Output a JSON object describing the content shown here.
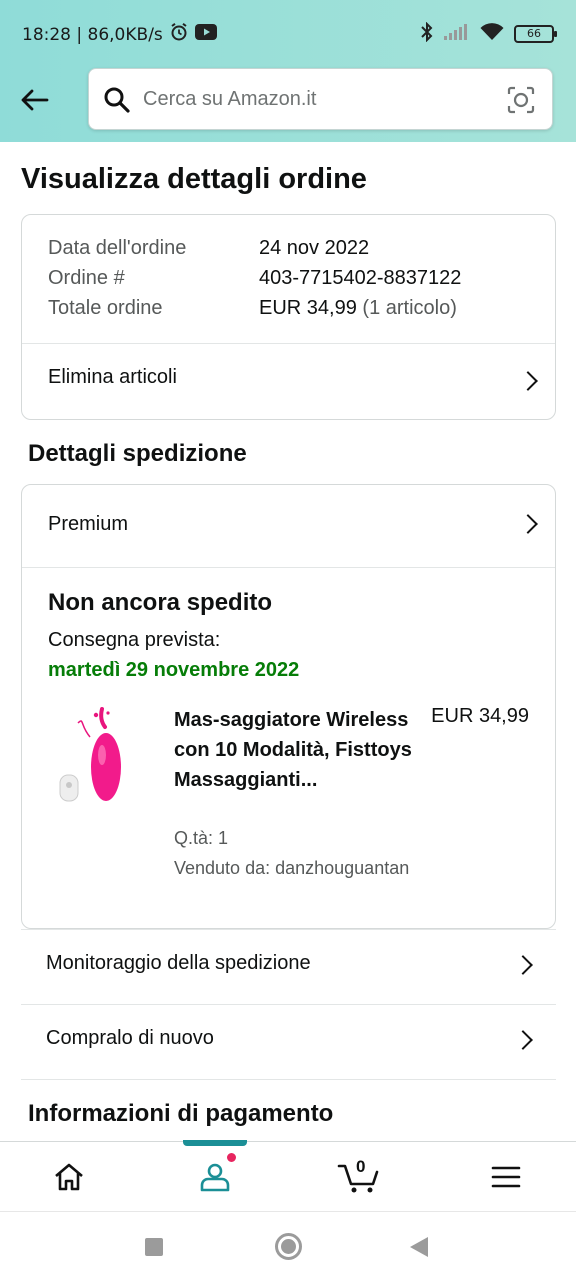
{
  "status_bar": {
    "time_speed": "18:28 | 86,0KB/s",
    "battery": "66"
  },
  "header": {
    "search_placeholder": "Cerca su Amazon.it"
  },
  "page": {
    "title": "Visualizza dettagli ordine"
  },
  "order_summary": {
    "rows": [
      {
        "label": "Data dell'ordine",
        "value": "24 nov 2022"
      },
      {
        "label": "Ordine #",
        "value": "403-7715402-8837122"
      },
      {
        "label": "Totale ordine",
        "value": "EUR 34,99",
        "extra": "(1 articolo)"
      }
    ],
    "action_label": "Elimina articoli"
  },
  "shipping": {
    "section_title": "Dettagli spedizione",
    "method": "Premium",
    "status": "Non ancora spedito",
    "delivery_label": "Consegna prevista:",
    "delivery_date": "martedì 29 novembre 2022",
    "product": {
      "title": "Mas-saggiatore Wireless con 10 Modalità, Fisttoys Massaggianti...",
      "price": "EUR 34,99",
      "qty": "Q.tà: 1",
      "seller": "Venduto da: danzhouguantan"
    }
  },
  "actions": [
    {
      "label": "Monitoraggio della spedizione"
    },
    {
      "label": "Compralo di nuovo"
    }
  ],
  "payment": {
    "section_title": "Informazioni di pagamento"
  },
  "bottom_nav": {
    "items": [
      "home-icon",
      "account-icon",
      "cart-icon",
      "menu-icon"
    ],
    "cart_count": "0",
    "active": "account"
  },
  "colors": {
    "accent": "#1b8f96",
    "delivery_green": "#067d08",
    "badge": "#e7255f"
  }
}
